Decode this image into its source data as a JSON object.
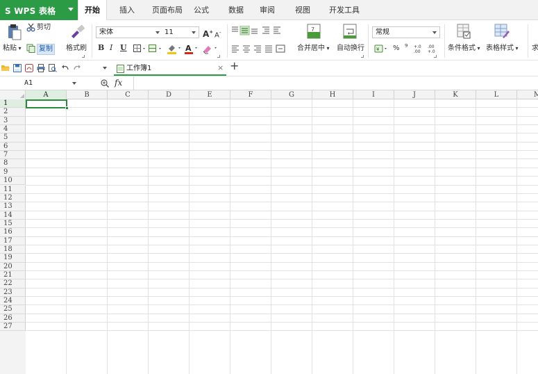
{
  "app": {
    "brand": "S WPS 表格"
  },
  "menu_tabs": [
    {
      "label": "开始"
    },
    {
      "label": "插入"
    },
    {
      "label": "页面布局"
    },
    {
      "label": "公式"
    },
    {
      "label": "数据"
    },
    {
      "label": "审阅"
    },
    {
      "label": "视图"
    },
    {
      "label": "开发工具"
    }
  ],
  "ribbon": {
    "paste": "粘贴",
    "cut": "剪切",
    "copy": "复制",
    "format_painter": "格式刷",
    "font_name": "宋体",
    "font_size": "11",
    "bold": "B",
    "italic": "I",
    "underline": "U",
    "grow_font": "A",
    "shrink_font": "A",
    "merge_center": "合并居中",
    "wrap_text": "自动换行",
    "number_format": "常规",
    "percent": "%",
    "thousands": "⁹",
    "cond_format": "条件格式",
    "table_style": "表格样式",
    "more": "求"
  },
  "colors": {
    "brand": "#2c9b46",
    "selection": "#2b8a3e",
    "header_bg": "#f3f3f3"
  },
  "document_tab": {
    "name": "工作簿1",
    "close": "×",
    "add": "+"
  },
  "formula_bar": {
    "cell_ref": "A1",
    "fx": "fx",
    "value": ""
  },
  "columns": [
    "A",
    "B",
    "C",
    "D",
    "E",
    "F",
    "G",
    "H",
    "I",
    "J",
    "K",
    "L",
    "M"
  ],
  "rows": [
    "1",
    "2",
    "3",
    "4",
    "5",
    "6",
    "7",
    "8",
    "9",
    "10",
    "11",
    "12",
    "13",
    "14",
    "15",
    "16",
    "17",
    "18",
    "19",
    "20",
    "21",
    "22",
    "23",
    "24",
    "25",
    "26",
    "27"
  ],
  "selected_cell": "A1"
}
